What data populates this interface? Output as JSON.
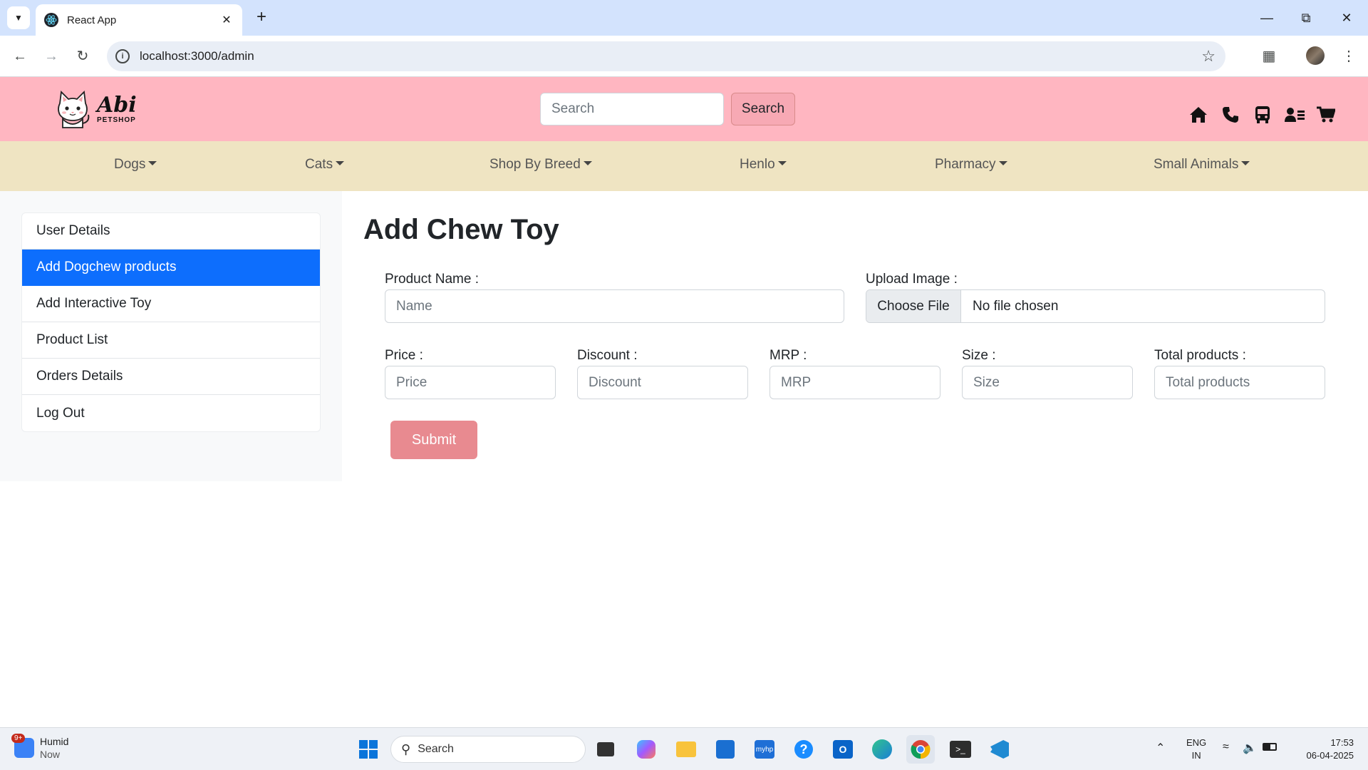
{
  "browser": {
    "tab_title": "React App",
    "new_tab_symbol": "+",
    "url": "localhost:3000/admin"
  },
  "header": {
    "logo_name": "Abi",
    "logo_sub": "PETSHOP",
    "search_placeholder": "Search",
    "search_button": "Search",
    "icons": [
      "home-icon",
      "phone-icon",
      "bus-icon",
      "user-list-icon",
      "cart-icon"
    ]
  },
  "categories": [
    "Dogs",
    "Cats",
    "Shop By Breed",
    "Henlo",
    "Pharmacy",
    "Small Animals"
  ],
  "sidebar": {
    "items": [
      "User Details",
      "Add Dogchew products",
      "Add Interactive Toy",
      "Product List",
      "Orders Details",
      "Log Out"
    ],
    "active": "Add Dogchew products"
  },
  "form": {
    "title": "Add Chew Toy",
    "product_name_label": "Product Name :",
    "product_name_placeholder": "Name",
    "upload_label": "Upload Image :",
    "choose_file": "Choose File",
    "no_file": "No file chosen",
    "price_label": "Price :",
    "price_placeholder": "Price",
    "discount_label": "Discount :",
    "discount_placeholder": "Discount",
    "mrp_label": "MRP :",
    "mrp_placeholder": "MRP",
    "size_label": "Size :",
    "size_placeholder": "Size",
    "total_label": "Total products :",
    "total_placeholder": "Total products",
    "submit": "Submit"
  },
  "taskbar": {
    "weather_title": "Humid",
    "weather_sub": "Now",
    "badge": "9+",
    "search_label": "Search",
    "lang_top": "ENG",
    "lang_bottom": "IN",
    "time": "17:53",
    "date": "06-04-2025"
  },
  "colors": {
    "header_bg": "#ffb6c1",
    "nav_bg": "#efe4c2",
    "active_item": "#0d6efd",
    "submit_bg": "#e88a90"
  }
}
